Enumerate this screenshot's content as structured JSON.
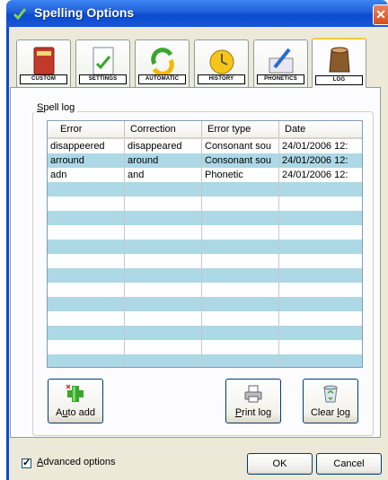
{
  "window": {
    "title": "Spelling Options",
    "close_symbol": "✕"
  },
  "tabs": [
    {
      "label": "CUSTOM",
      "icon": "dictionary-book-icon"
    },
    {
      "label": "SETTINGS",
      "icon": "checklist-document-icon"
    },
    {
      "label": "AUTOMATIC",
      "icon": "recycle-arrows-icon"
    },
    {
      "label": "HISTORY",
      "icon": "clock-icon"
    },
    {
      "label": "PHONETICS",
      "icon": "pen-writing-icon"
    },
    {
      "label": "LOG",
      "icon": "tree-log-icon",
      "active": true
    }
  ],
  "spell_log": {
    "group_label_prefix": "S",
    "group_label_rest": "pell log",
    "columns": [
      "Error",
      "Correction",
      "Error type",
      "Date"
    ],
    "rows": [
      [
        "disappeered",
        "disappeared",
        "Consonant sou",
        "24/01/2006 12:"
      ],
      [
        "arround",
        "around",
        "Consonant sou",
        "24/01/2006 12:"
      ],
      [
        "adn",
        "and",
        "Phonetic",
        "24/01/2006 12:"
      ],
      [
        "",
        "",
        "",
        ""
      ],
      [
        "",
        "",
        "",
        ""
      ],
      [
        "",
        "",
        "",
        ""
      ],
      [
        "",
        "",
        "",
        ""
      ],
      [
        "",
        "",
        "",
        ""
      ],
      [
        "",
        "",
        "",
        ""
      ],
      [
        "",
        "",
        "",
        ""
      ],
      [
        "",
        "",
        "",
        ""
      ],
      [
        "",
        "",
        "",
        ""
      ],
      [
        "",
        "",
        "",
        ""
      ],
      [
        "",
        "",
        "",
        ""
      ],
      [
        "",
        "",
        "",
        ""
      ],
      [
        "",
        "",
        "",
        ""
      ]
    ]
  },
  "actions": {
    "auto_add": {
      "pre": "A",
      "ul": "u",
      "post": "to add"
    },
    "print_log": {
      "pre": "",
      "ul": "P",
      "post": "rint log"
    },
    "clear_log": {
      "pre": "Clear ",
      "ul": "l",
      "post": "og"
    }
  },
  "footer": {
    "advanced_checked": true,
    "checkmark": "✓",
    "advanced_ul": "A",
    "advanced_rest": "dvanced options",
    "ok_label": "OK",
    "cancel_label": "Cancel"
  },
  "colors": {
    "title_blue": "#0a4bd0",
    "row_highlight": "#add8e6",
    "tab_active_border": "#ffc83c"
  }
}
